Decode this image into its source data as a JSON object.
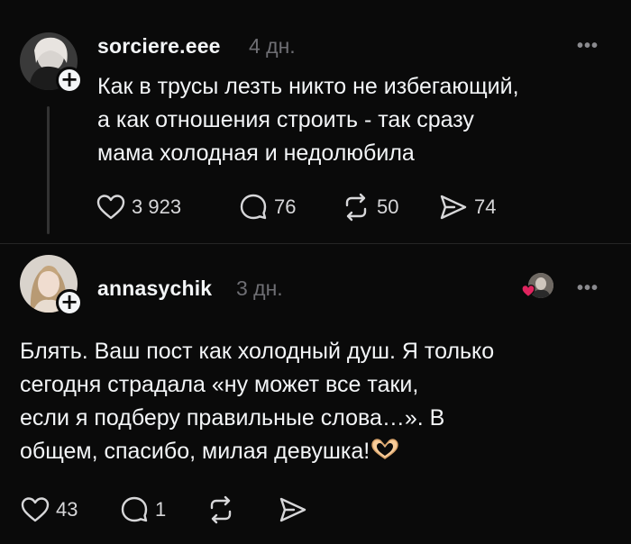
{
  "posts": [
    {
      "username": "sorciere.eee",
      "time": "4 дн.",
      "more": "•••",
      "text_lines": [
        "Как в трусы лезть никто не избегающий,",
        "а как отношения строить - так сразу",
        "мама холодная и недолюбила"
      ],
      "likes": "3 923",
      "comments": "76",
      "reposts": "50",
      "shares": "74"
    },
    {
      "username": "annasychik",
      "time": "3 дн.",
      "more": "•••",
      "text_lines": [
        "Блять. Ваш пост как холодный душ. Я только",
        "сегодня страдала «ну может все таки,",
        "если я подберу правильные слова…». В",
        "общем, спасибо, милая девушка!"
      ],
      "likes": "43",
      "comments": "1"
    }
  ],
  "icons": {
    "like": "heart-icon",
    "comment": "comment-bubble-icon",
    "repost": "repost-arrows-icon",
    "share": "send-icon",
    "follow": "plus-icon",
    "emoji": "heart-hands-emoji"
  },
  "colors": {
    "background": "#0a0a0a",
    "text": "#f3f5f7",
    "muted": "#6e6e73",
    "liked_heart": "#e0245e"
  }
}
